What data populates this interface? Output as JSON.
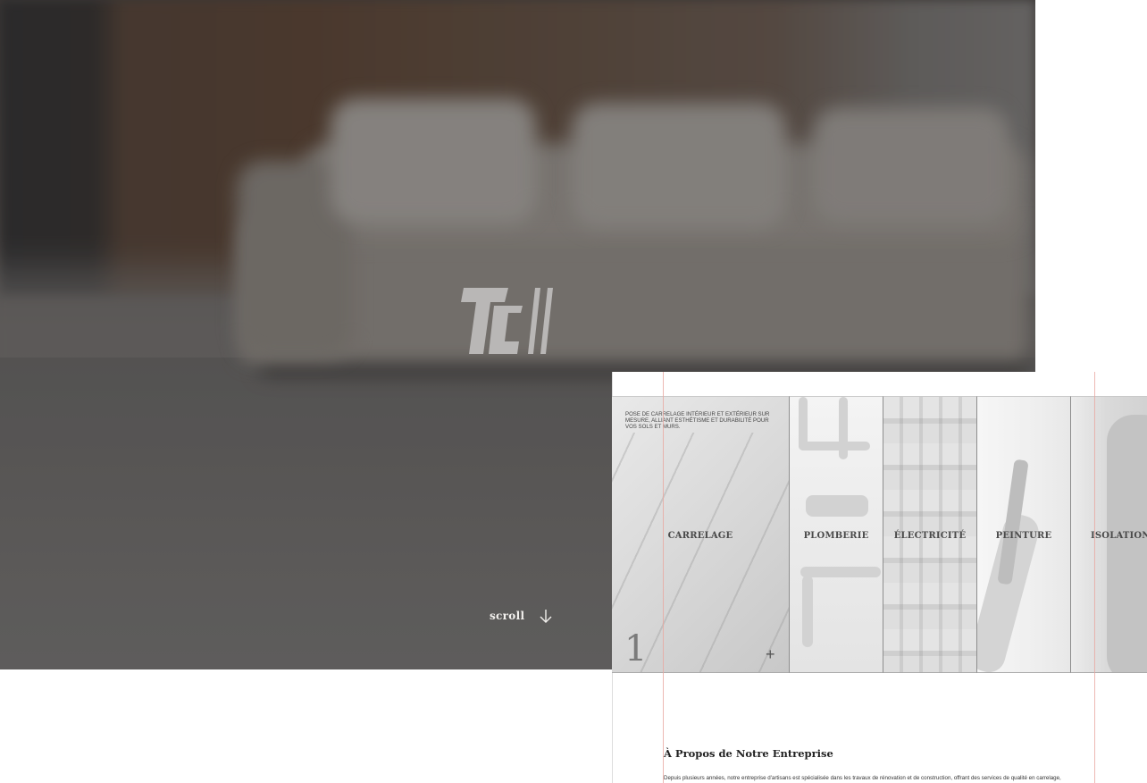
{
  "hero": {
    "logo": {
      "icon": "tc-logo-icon",
      "text": "TC"
    },
    "scroll_label": "scroll",
    "scroll_icon": "arrow-down-icon"
  },
  "services": [
    {
      "label": "CARRELAGE",
      "description": "POSE DE CARRELAGE INTÉRIEUR ET EXTÉRIEUR SUR MESURE, ALLIANT ESTHÉTISME ET DURABILITÉ POUR VOS SOLS ET MURS.",
      "number": "1",
      "expand_icon": "plus-icon",
      "active": true
    },
    {
      "label": "PLOMBERIE"
    },
    {
      "label": "ÉLECTRICITÉ"
    },
    {
      "label": "PEINTURE"
    },
    {
      "label": "ISOLATION"
    }
  ],
  "about": {
    "title": "À Propos de Notre Entreprise",
    "text": "Depuis plusieurs années, notre entreprise d'artisans est spécialisée dans les travaux de rénovation et de construction, offrant des services de qualité en carrelage,"
  },
  "colors": {
    "guide_line": "#e9a7a0",
    "scroll_text": "#f3f1ee"
  }
}
